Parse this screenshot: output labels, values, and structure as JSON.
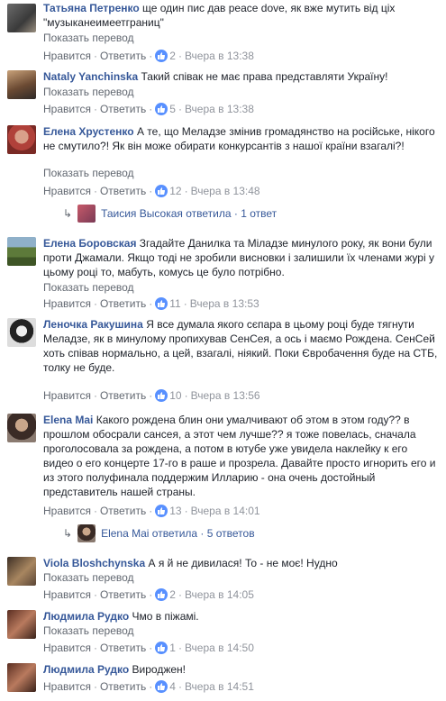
{
  "ui": {
    "translate_label": "Показать перевод",
    "like_label": "Нравится",
    "reply_label": "Ответить",
    "separator": "·"
  },
  "comments": [
    {
      "author": "Татьяна Петренко",
      "text": "ще один пис дав peace dove, як вже мутить від ціх \"музыканеимеетграниц\"",
      "likes": "2",
      "time": "Вчера в 13:38"
    },
    {
      "author": "Nataly Yanchinska",
      "text": "Такий співак не має права представляти Україну!",
      "likes": "5",
      "time": "Вчера в 13:38"
    },
    {
      "author": "Елена Хрустенко",
      "text": "А те, що Меладзе змінив громадянство на російське, нікого не смутило?! Як він може обирати конкурсантів з нашої країни взагалі?!",
      "likes": "12",
      "time": "Вчера в 13:48",
      "replies": {
        "name": "Таисия Высокая",
        "text": "ответила · 1 ответ"
      }
    },
    {
      "author": "Елена Боровская",
      "text": "Згадайте Данилка та Міладзе минулого року, як вони були проти Джамали. Якщо тоді не зробили висновки і залишили їх членами журі у цьому році то, мабуть, комусь це було потрібно.",
      "likes": "11",
      "time": "Вчера в 13:53"
    },
    {
      "author": "Леночка Ракушина",
      "text": "Я все думала якого сєпара в цьому році буде тягнути Меладзе, як в минулому пропихував СенСея, а ось і маємо Рождена. СенСей хоть співав нормально, а цей, взагалі, ніякий. Поки Євробачення буде на СТБ, толку не буде.",
      "likes": "10",
      "time": "Вчера в 13:56"
    },
    {
      "author": "Elena Mai",
      "text": "Какого рождена блин они умалчивают об этом в этом году?? в прошлом обосрали сансея, а этот чем лучше?? я тоже повелась, сначала проголосовала за рождена, а потом в ютубе уже увидела наклейку к его видео о его концерте 17-го в раше и прозрела. Давайте просто игнорить его и из этого полуфинала поддержим Илларию - она очень достойный представитель нашей страны.",
      "likes": "13",
      "time": "Вчера в 14:01",
      "replies": {
        "name": "Elena Mai",
        "text": "ответила · 5 ответов"
      }
    },
    {
      "author": "Viola Bloshchynska",
      "text": "А я й не дивилася! То - не моє! Нудно",
      "likes": "2",
      "time": "Вчера в 14:05"
    },
    {
      "author": "Людмила Рудко",
      "text": "Чмо в піжамі.",
      "likes": "1",
      "time": "Вчера в 14:50"
    },
    {
      "author": "Людмила Рудко",
      "text": "Вироджен!",
      "likes": "4",
      "time": "Вчера в 14:51"
    }
  ],
  "colors": {
    "link": "#365899",
    "meta": "#90949c",
    "like_badge": "#5890ff"
  }
}
